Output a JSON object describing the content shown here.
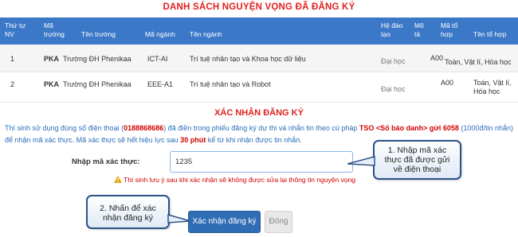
{
  "list_title": "DANH SÁCH NGUYỆN VỌNG ĐÃ ĐĂNG KÝ",
  "table": {
    "headers": {
      "order": [
        "Thứ tự",
        "NV"
      ],
      "school_code": [
        "Mã",
        "trường"
      ],
      "school_name": "Tên trường",
      "major_code": "Mã ngành",
      "major_name": "Tên ngành",
      "training_type": [
        "Hệ đào",
        "tạo"
      ],
      "description": [
        "Mô",
        "tả"
      ],
      "combo_code": [
        "Mã tổ",
        "hợp"
      ],
      "combo_name": "Tên tổ hợp"
    },
    "rows": [
      {
        "order": "1",
        "school_code": "PKA",
        "school_name": "Trường ĐH Phenikaa",
        "major_code": "ICT-AI",
        "major_name": "Trí tuệ nhân tạo và Khoa học dữ liệu",
        "training_type": "Đại học",
        "combo_code": "A00",
        "combo_name": "Toán, Vật lí, Hóa học"
      },
      {
        "order": "2",
        "school_code": "PKA",
        "school_name": "Trường ĐH Phenikaa",
        "major_code": "EEE-A1",
        "major_name": "Trí tuệ nhân tạo và Robot",
        "training_type": "Đại học",
        "combo_code": "A00",
        "combo_name": [
          "Toán, Vật lí,",
          "Hóa học"
        ]
      }
    ]
  },
  "confirm": {
    "title": "XÁC NHẬN ĐĂNG KÝ",
    "info_p1": "Thí sinh sử dụng đúng số điện thoại (",
    "phone": "0188868686",
    "info_p2": ") đã điền trong phiếu đăng ký dự thi và nhắn tin theo cú pháp ",
    "sms_syntax": "TSO <Số báo danh> gửi 6058",
    "info_p3": " (1000đ/tin nhắn) để nhận mã xác thực. Mã xác thực sẽ hết hiệu lực sau ",
    "expire": "30 phút",
    "info_p4": " kể từ khi nhận được tin nhắn.",
    "code_label": "Nhập mã xác thực:",
    "code_value": "1235",
    "warning": "Thí sinh lưu ý sau khi xác nhận sẽ không được sửa lại thông tin nguyện vọng",
    "confirm_button": "Xác nhận đăng ký",
    "close_button": "Đóng"
  },
  "callouts": {
    "step1": "1. Nhập mã xác thực đã được gửi về điện thoại",
    "step2": "2. Nhấn để xác nhận đăng ký"
  },
  "colors": {
    "header_bg": "#3c78c8",
    "title_red": "#e02020",
    "info_blue": "#2a6ebb",
    "button_blue": "#2f6db5",
    "callout_border": "#2b5288"
  }
}
